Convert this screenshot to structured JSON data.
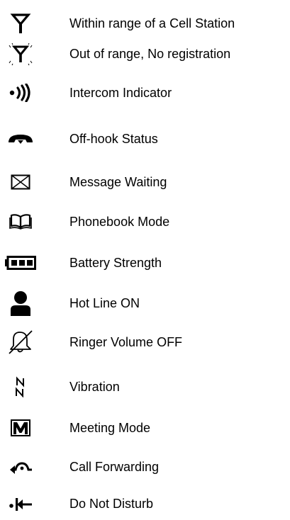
{
  "legend": {
    "items": [
      {
        "icon": "antenna-in-range-icon",
        "label": "Within range of a Cell Station"
      },
      {
        "icon": "antenna-out-of-range-icon",
        "label": "Out of range, No registration"
      },
      {
        "icon": "intercom-icon",
        "label": "Intercom Indicator"
      },
      {
        "icon": "off-hook-handset-icon",
        "label": "Off-hook Status"
      },
      {
        "icon": "envelope-icon",
        "label": "Message Waiting"
      },
      {
        "icon": "open-book-icon",
        "label": "Phonebook Mode"
      },
      {
        "icon": "battery-icon",
        "label": "Battery Strength"
      },
      {
        "icon": "person-icon",
        "label": "Hot Line ON"
      },
      {
        "icon": "bell-crossed-icon",
        "label": "Ringer Volume OFF"
      },
      {
        "icon": "vibration-icon",
        "label": "Vibration"
      },
      {
        "icon": "meeting-m-icon",
        "label": "Meeting Mode"
      },
      {
        "icon": "call-forwarding-icon",
        "label": "Call Forwarding"
      },
      {
        "icon": "do-not-disturb-icon",
        "label": "Do Not Disturb"
      }
    ]
  }
}
